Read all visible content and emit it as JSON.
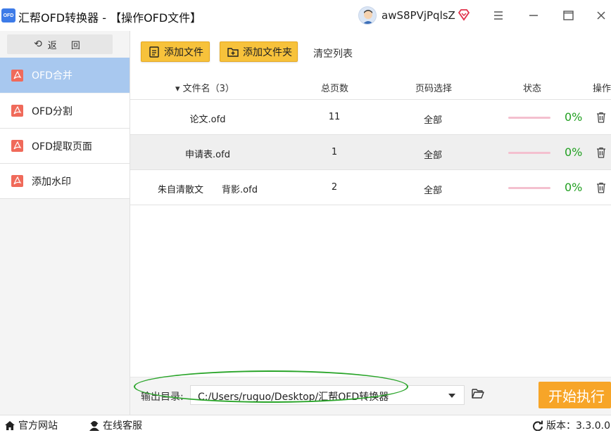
{
  "app": {
    "logo_text": "OFD",
    "title": "汇帮OFD转换器 - 【操作OFD文件】",
    "username": "awS8PVjPqlsZ"
  },
  "sidebar": {
    "back_label": "返 回",
    "items": [
      {
        "label": "OFD合并",
        "active": true
      },
      {
        "label": "OFD分割",
        "active": false
      },
      {
        "label": "OFD提取页面",
        "active": false
      },
      {
        "label": "添加水印",
        "active": false
      }
    ]
  },
  "toolbar": {
    "add_file": "添加文件",
    "add_folder": "添加文件夹",
    "clear_list": "清空列表"
  },
  "table": {
    "headers": {
      "name": "▾ 文件名（3）",
      "pages": "总页数",
      "range": "页码选择",
      "status": "状态",
      "action": "操作"
    },
    "rows": [
      {
        "name": "论文.ofd",
        "pages": "11",
        "range": "全部",
        "progress": 0,
        "percent": "0%"
      },
      {
        "name": "申请表.ofd",
        "pages": "1",
        "range": "全部",
        "progress": 0,
        "percent": "0%"
      },
      {
        "name": "朱自清散文　　背影.ofd",
        "pages": "2",
        "range": "全部",
        "progress": 0,
        "percent": "0%"
      }
    ]
  },
  "output": {
    "label": "输出目录:",
    "path": "C:/Users/ruguo/Desktop/汇帮OFD转换器",
    "start_label": "开始执行"
  },
  "statusbar": {
    "website": "官方网站",
    "support": "在线客服",
    "version": "版本：3.3.0.0"
  },
  "colors": {
    "accent": "#f7c23b",
    "active_nav": "#a8c8ef",
    "start": "#f7a528",
    "percent": "#22a022",
    "annotation": "#2aa52a"
  }
}
